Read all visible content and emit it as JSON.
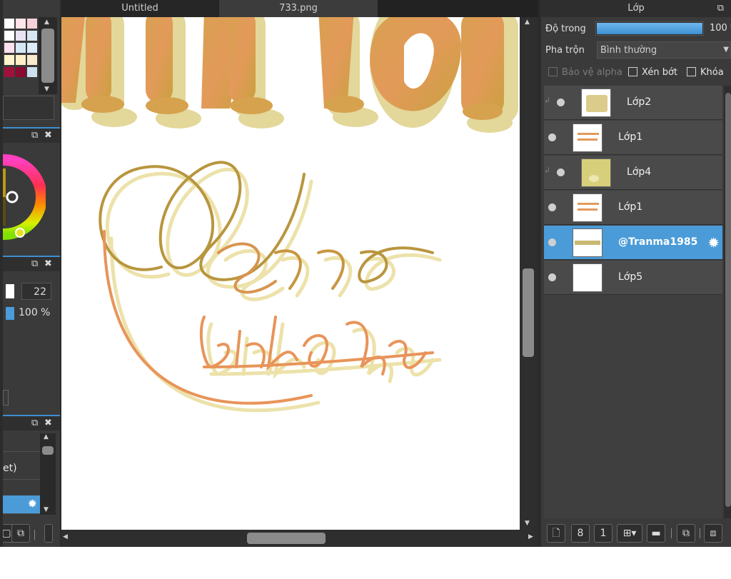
{
  "tabs": [
    {
      "label": "Untitled"
    },
    {
      "label": "733.png"
    }
  ],
  "left_dock": {
    "brush_size": "22",
    "opacity": "100 %",
    "list_partial_text": "et)"
  },
  "layers_panel": {
    "title": "Lớp",
    "opacity_label": "Độ trong",
    "opacity_value": "100 %",
    "opacity_fraction": 1.0,
    "blend_label": "Pha trộn",
    "blend_value": "Bình thường",
    "protect_alpha_label": "Bảo vệ alpha",
    "clipping_label": "Xén bớt",
    "lock_label": "Khóa",
    "layers": [
      {
        "name": "Lớp2",
        "clipped": true,
        "selected": false
      },
      {
        "name": "Lớp1",
        "clipped": false,
        "selected": false
      },
      {
        "name": "Lớp4",
        "clipped": true,
        "selected": false
      },
      {
        "name": "Lớp1",
        "clipped": false,
        "selected": false
      },
      {
        "name": "@Tranma1985",
        "clipped": false,
        "selected": true
      },
      {
        "name": "Lớp5",
        "clipped": false,
        "selected": false
      }
    ]
  },
  "canvas_art": {
    "line1": "Happy",
    "line2": "birthday"
  },
  "colors": {
    "accent": "#4a9bd8",
    "ink_gold": "#b8963e",
    "ink_orange": "#e8945a",
    "shadow_yellow": "#e6dc9a"
  }
}
